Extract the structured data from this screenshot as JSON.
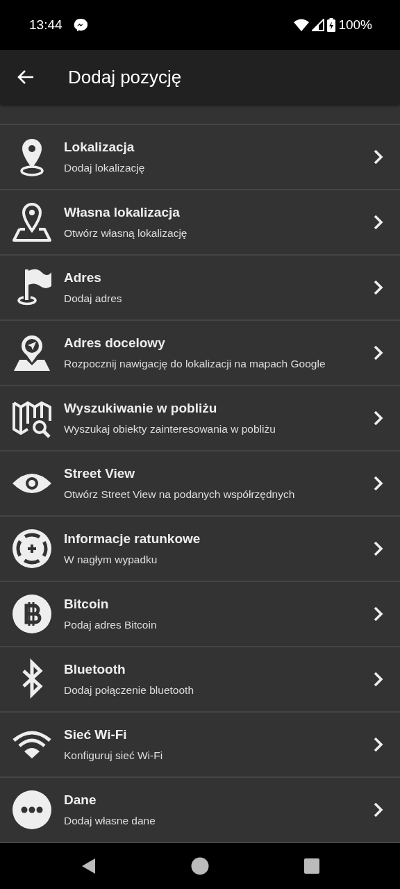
{
  "status_bar": {
    "time": "13:44",
    "battery": "100%"
  },
  "app_bar": {
    "title": "Dodaj pozycję"
  },
  "items": [
    {
      "kind": "pin",
      "title": "Lokalizacja",
      "subtitle": "Dodaj lokalizację"
    },
    {
      "kind": "map-pin",
      "title": "Własna lokalizacja",
      "subtitle": "Otwórz własną lokalizację"
    },
    {
      "kind": "flag",
      "title": "Adres",
      "subtitle": "Dodaj adres"
    },
    {
      "kind": "nav-pin",
      "title": "Adres docelowy",
      "subtitle": "Rozpocznij nawigację do lokalizacji na mapach Google"
    },
    {
      "kind": "map-search",
      "title": "Wyszukiwanie w pobliżu",
      "subtitle": "Wyszukaj obiekty zainteresowania w pobliżu"
    },
    {
      "kind": "eye",
      "title": "Street View",
      "subtitle": "Otwórz Street View na podanych współrzędnych"
    },
    {
      "kind": "lifebuoy",
      "title": "Informacje ratunkowe",
      "subtitle": "W nagłym wypadku"
    },
    {
      "kind": "bitcoin",
      "title": "Bitcoin",
      "subtitle": "Podaj adres Bitcoin"
    },
    {
      "kind": "bluetooth",
      "title": "Bluetooth",
      "subtitle": "Dodaj połączenie bluetooth"
    },
    {
      "kind": "wifi",
      "title": "Sieć Wi-Fi",
      "subtitle": "Konfiguruj sieć Wi-Fi"
    },
    {
      "kind": "dots",
      "title": "Dane",
      "subtitle": "Dodaj własne dane"
    }
  ]
}
